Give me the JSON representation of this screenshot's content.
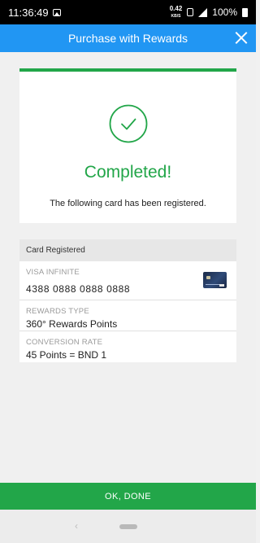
{
  "status_bar": {
    "time": "11:36:49",
    "net_speed_value": "0.42",
    "net_speed_unit": "KB/S",
    "battery": "100%"
  },
  "header": {
    "title": "Purchase with Rewards",
    "close_icon": "close-icon"
  },
  "success": {
    "icon": "check-circle-icon",
    "title": "Completed!",
    "message": "The following card has been registered."
  },
  "details": {
    "section_title": "Card Registered",
    "card": {
      "label": "VISA INFINITE",
      "number": "4388 0888 0888 0888",
      "image": "credit-card-icon"
    },
    "rewards": {
      "label": "REWARDS TYPE",
      "value": "360° Rewards Points"
    },
    "conversion": {
      "label": "CONVERSION RATE",
      "value": "45 Points = BND 1"
    }
  },
  "actions": {
    "done_label": "OK, DONE"
  },
  "colors": {
    "header": "#2196f3",
    "success": "#22a649",
    "status_bar": "#000000"
  },
  "nav": {
    "back_icon": "chevron-left-icon",
    "home_icon": "home-pill-icon"
  }
}
